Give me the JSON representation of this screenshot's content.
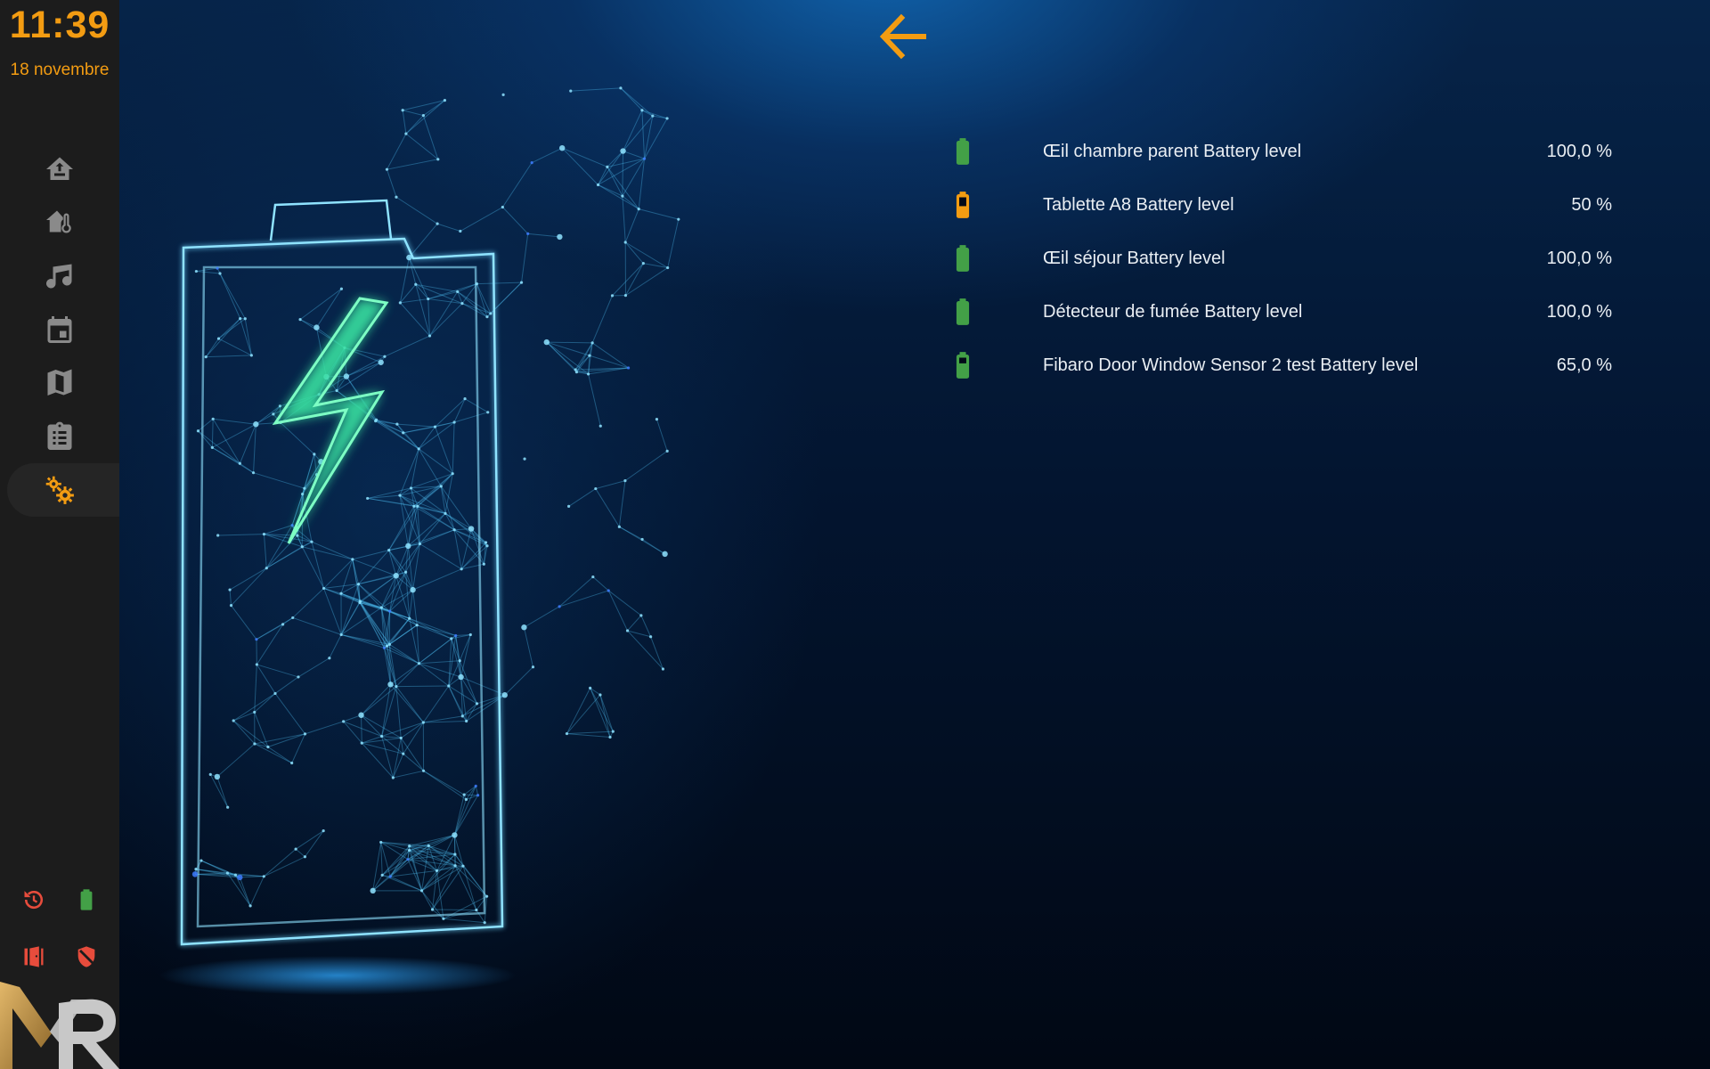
{
  "clock": {
    "time": "11:39",
    "date": "18 novembre"
  },
  "sidebar": {
    "items": [
      {
        "icon": "home-import-icon",
        "label": ""
      },
      {
        "icon": "home-thermometer-icon",
        "label": ""
      },
      {
        "icon": "music-note-icon",
        "label": ""
      },
      {
        "icon": "calendar-icon",
        "label": ""
      },
      {
        "icon": "map-icon",
        "label": ""
      },
      {
        "icon": "clipboard-list-icon",
        "label": ""
      },
      {
        "icon": "gears-icon",
        "label": "",
        "active": true
      }
    ],
    "status": [
      {
        "icon": "history-icon",
        "color": "#e74c3c"
      },
      {
        "icon": "battery-icon",
        "color": "#43a047"
      },
      {
        "icon": "door-open-icon",
        "color": "#e74c3c"
      },
      {
        "icon": "shield-off-icon",
        "color": "#e74c3c"
      }
    ]
  },
  "colors": {
    "accent": "#f39c12",
    "ok": "#43a047",
    "warning": "#f39c12",
    "alert": "#e74c3c"
  },
  "batteries": [
    {
      "name": "Œil chambre parent Battery level",
      "value": "100,0 %",
      "level": 100,
      "status": "ok"
    },
    {
      "name": "Tablette A8 Battery level",
      "value": "50 %",
      "level": 50,
      "status": "warning"
    },
    {
      "name": "Œil séjour Battery level",
      "value": "100,0 %",
      "level": 100,
      "status": "ok"
    },
    {
      "name": "Détecteur de fumée Battery level",
      "value": "100,0 %",
      "level": 100,
      "status": "ok"
    },
    {
      "name": "Fibaro Door Window Sensor 2 test Battery level",
      "value": "65,0 %",
      "level": 65,
      "status": "ok"
    }
  ]
}
